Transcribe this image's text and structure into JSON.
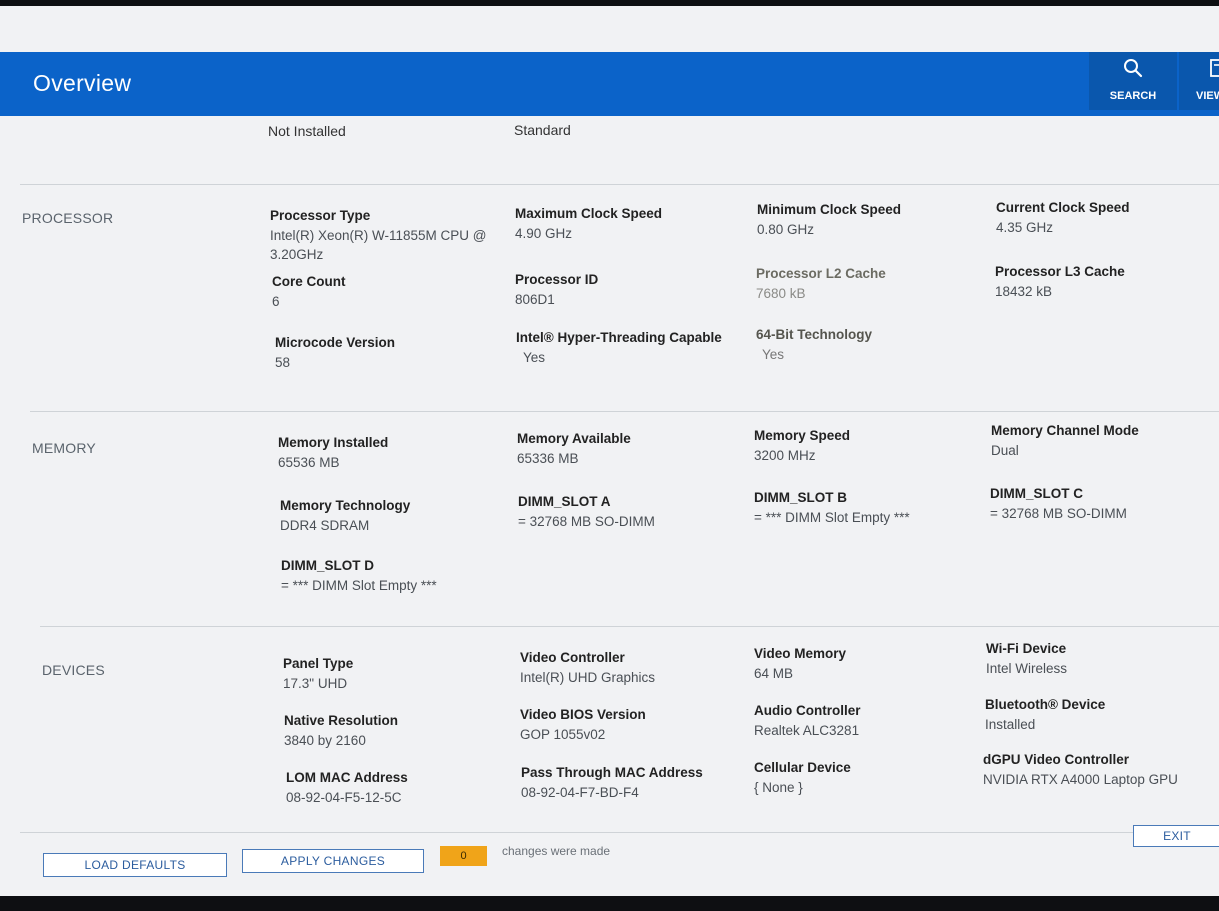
{
  "header": {
    "title": "Overview",
    "search_label": "SEARCH",
    "view_label": "VIEW"
  },
  "prior_row": [
    "Not Installed",
    "Standard"
  ],
  "sections": [
    {
      "name": "PROCESSOR",
      "items": [
        {
          "label": "Processor Type",
          "value": "Intel(R) Xeon(R) W-11855M CPU @ 3.20GHz"
        },
        {
          "label": "Maximum Clock Speed",
          "value": "4.90 GHz"
        },
        {
          "label": "Minimum Clock Speed",
          "value": "0.80 GHz"
        },
        {
          "label": "Current Clock Speed",
          "value": "4.35 GHz"
        },
        {
          "label": "Core Count",
          "value": "6"
        },
        {
          "label": "Processor ID",
          "value": "806D1"
        },
        {
          "label": "Processor L2 Cache",
          "value": "7680 kB"
        },
        {
          "label": "Processor L3 Cache",
          "value": "18432 kB"
        },
        {
          "label": "Microcode Version",
          "value": "58"
        },
        {
          "label": "Intel® Hyper-Threading Capable",
          "value": "Yes"
        },
        {
          "label": "64-Bit Technology",
          "value": "Yes"
        }
      ]
    },
    {
      "name": "MEMORY",
      "items": [
        {
          "label": "Memory Installed",
          "value": "65536 MB"
        },
        {
          "label": "Memory Available",
          "value": "65336 MB"
        },
        {
          "label": "Memory Speed",
          "value": "3200 MHz"
        },
        {
          "label": "Memory Channel Mode",
          "value": "Dual"
        },
        {
          "label": "Memory Technology",
          "value": "DDR4 SDRAM"
        },
        {
          "label": "DIMM_SLOT A",
          "value": "= 32768 MB SO-DIMM"
        },
        {
          "label": "DIMM_SLOT B",
          "value": "= *** DIMM Slot Empty ***"
        },
        {
          "label": "DIMM_SLOT C",
          "value": "= 32768 MB SO-DIMM"
        },
        {
          "label": "DIMM_SLOT D",
          "value": "= *** DIMM Slot Empty ***"
        }
      ]
    },
    {
      "name": "DEVICES",
      "items": [
        {
          "label": "Panel Type",
          "value": "17.3\" UHD"
        },
        {
          "label": "Video Controller",
          "value": "Intel(R) UHD Graphics"
        },
        {
          "label": "Video Memory",
          "value": "64 MB"
        },
        {
          "label": "Wi-Fi Device",
          "value": "Intel Wireless"
        },
        {
          "label": "Native Resolution",
          "value": "3840 by 2160"
        },
        {
          "label": "Video BIOS Version",
          "value": "GOP 1055v02"
        },
        {
          "label": "Audio Controller",
          "value": "Realtek ALC3281"
        },
        {
          "label": "Bluetooth® Device",
          "value": "Installed"
        },
        {
          "label": "LOM MAC Address",
          "value": "08-92-04-F5-12-5C"
        },
        {
          "label": "Pass Through MAC Address",
          "value": "08-92-04-F7-BD-F4"
        },
        {
          "label": "Cellular Device",
          "value": "{ None }"
        },
        {
          "label": "dGPU Video Controller",
          "value": "NVIDIA RTX A4000 Laptop GPU"
        }
      ]
    }
  ],
  "footer": {
    "load_defaults": "LOAD DEFAULTS",
    "apply_changes": "APPLY CHANGES",
    "changes_count": "0",
    "changes_text": "changes were made",
    "exit": "EXIT"
  }
}
